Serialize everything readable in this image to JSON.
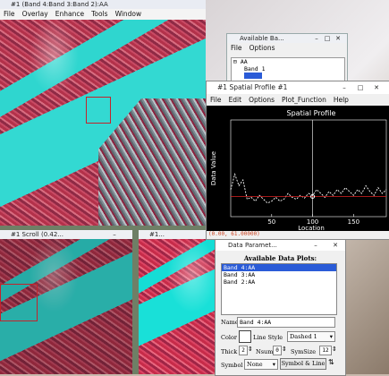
{
  "main_window": {
    "title": "#1 (Band 4:Band 3:Band 2):AA",
    "menu": [
      "File",
      "Overlay",
      "Enhance",
      "Tools",
      "Window"
    ]
  },
  "scroll_window": {
    "title": "#1 Scroll (0.42..."
  },
  "zoom_window": {
    "title": "#1..."
  },
  "available_bands": {
    "title": "Available Ba...",
    "menu": [
      "File",
      "Options"
    ],
    "items": [
      "AA",
      "Band 1"
    ]
  },
  "spatial_profile": {
    "title": "#1 Spatial Profile #1",
    "menu": [
      "File",
      "Edit",
      "Options",
      "Plot_Function",
      "Help"
    ],
    "status": "(0.00, 61.00000)"
  },
  "chart_data": {
    "type": "line",
    "title": "Spatial Profile",
    "xlabel": "Location",
    "ylabel": "Data Value",
    "xlim": [
      0,
      190
    ],
    "ylim": [
      0,
      250
    ],
    "x_ticks": [
      "50",
      "100",
      "150"
    ],
    "cursor_x": 100,
    "series": [
      {
        "color": "#ffffff",
        "style": "dashed",
        "x": [
          0,
          5,
          10,
          15,
          20,
          25,
          30,
          35,
          40,
          45,
          50,
          55,
          60,
          65,
          70,
          75,
          80,
          85,
          90,
          95,
          100,
          105,
          110,
          115,
          120,
          125,
          130,
          135,
          140,
          145,
          150,
          155,
          160,
          165,
          170,
          175,
          180,
          185,
          190
        ],
        "values": [
          70,
          110,
          80,
          95,
          45,
          50,
          40,
          55,
          45,
          35,
          40,
          50,
          40,
          45,
          60,
          50,
          45,
          55,
          48,
          60,
          55,
          70,
          60,
          50,
          65,
          55,
          70,
          60,
          75,
          65,
          55,
          70,
          60,
          80,
          65,
          55,
          75,
          60,
          70
        ]
      },
      {
        "color": "#dd2222",
        "style": "solid",
        "x": [
          0,
          20,
          40,
          60,
          80,
          100,
          120,
          140,
          160,
          190
        ],
        "values": [
          52,
          52,
          52,
          52,
          52,
          52,
          52,
          52,
          52,
          52
        ]
      }
    ]
  },
  "data_params": {
    "title": "Data Paramet...",
    "header": "Available Data Plots:",
    "plots": [
      "Band 4:AA",
      "Band 3:AA",
      "Band 2:AA"
    ],
    "name_label": "Name",
    "name_value": "Band 4:AA",
    "color_label": "Color",
    "line_style_label": "Line Style",
    "line_style_value": "Dashed 1",
    "thick_label": "Thick",
    "thick_value": "2",
    "nsum_label": "Nsum",
    "nsum_value": "0",
    "symsize_label": "SymSize",
    "symsize_value": "12",
    "symbol_label": "Symbol",
    "symbol_value": "None",
    "symbol_line_button": "Symbol & Line"
  }
}
